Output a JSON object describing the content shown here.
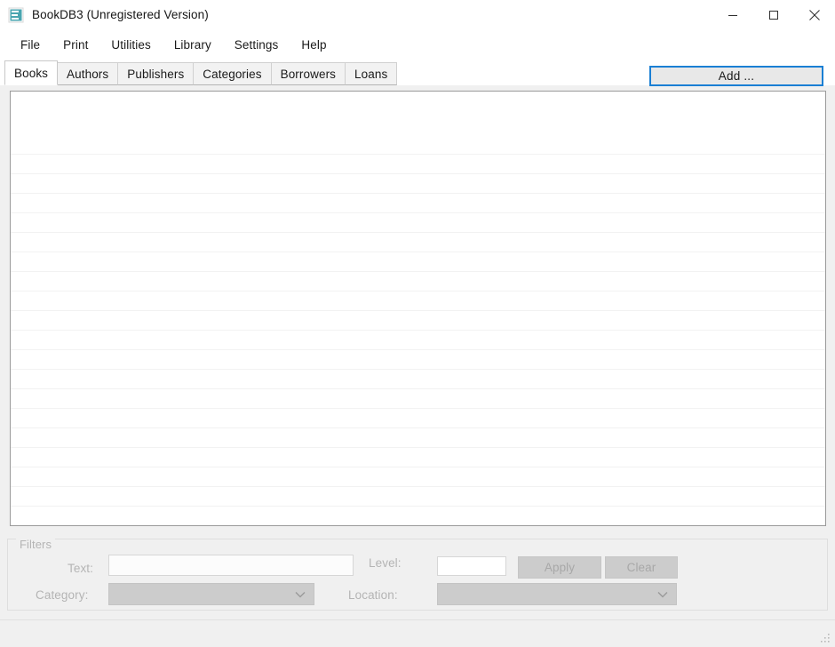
{
  "window": {
    "title": "BookDB3 (Unregistered Version)",
    "icon": "app-logo-icon",
    "controls": [
      {
        "name": "minimize",
        "icon": "minimize-icon"
      },
      {
        "name": "maximize",
        "icon": "maximize-icon"
      },
      {
        "name": "close",
        "icon": "close-icon"
      }
    ]
  },
  "menubar": {
    "items": [
      {
        "label": "File"
      },
      {
        "label": "Print"
      },
      {
        "label": "Utilities"
      },
      {
        "label": "Library"
      },
      {
        "label": "Settings"
      },
      {
        "label": "Help"
      }
    ]
  },
  "tabs": {
    "selected": "Books",
    "items": [
      {
        "label": "Books"
      },
      {
        "label": "Authors"
      },
      {
        "label": "Publishers"
      },
      {
        "label": "Categories"
      },
      {
        "label": "Borrowers"
      },
      {
        "label": "Loans"
      }
    ]
  },
  "toolbar": {
    "add_label": "Add ..."
  },
  "list": {
    "rows": [],
    "row_count": 0,
    "empty": true,
    "visible_separator_rows": 24
  },
  "filters": {
    "legend": "Filters",
    "enabled": false,
    "text": {
      "label": "Text:",
      "value": "",
      "placeholder": ""
    },
    "category": {
      "label": "Category:",
      "value": "",
      "arrow_icon": "chevron-down-icon"
    },
    "level": {
      "label": "Level:",
      "value": "",
      "placeholder": ""
    },
    "location": {
      "label": "Location:",
      "value": "",
      "arrow_icon": "chevron-down-icon"
    },
    "apply_label": "Apply",
    "clear_label": "Clear"
  },
  "statusbar": {
    "text": "",
    "grip_icon": "resize-grip-icon"
  },
  "colors": {
    "accent": "#1a7fd4",
    "logo": "#3c9aa8",
    "window_bg": "#f0f0f0",
    "panel_bg": "#ffffff",
    "disabled_text": "#b4b4b4",
    "control_disabled_bg": "#cccccc"
  }
}
